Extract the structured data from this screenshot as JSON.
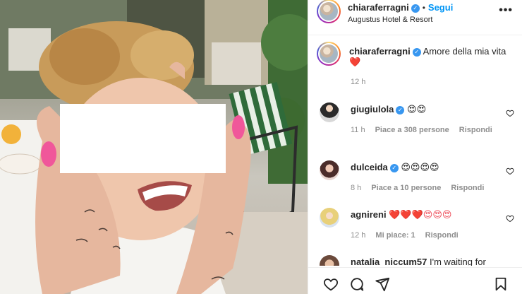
{
  "post": {
    "author": "chiaraferragni",
    "follow_label": "Segui",
    "separator": "•",
    "location": "Augustus Hotel & Resort",
    "more_icon": "more-horizontal-icon"
  },
  "caption": {
    "author": "chiaraferragni",
    "text": "Amore della mia vita",
    "emoji": "❤️",
    "time": "12 h"
  },
  "comments": [
    {
      "author": "giugiulola",
      "verified": true,
      "text": "😍😍",
      "time": "11 h",
      "likes": "Piace a 308 persone",
      "reply": "Rispondi"
    },
    {
      "author": "dulceida",
      "verified": true,
      "text": "😍😍😍😍",
      "time": "8 h",
      "likes": "Piace a 10 persone",
      "reply": "Rispondi"
    },
    {
      "author": "agnireni",
      "verified": false,
      "text": "❤️❤️❤️😍😍😍",
      "time": "12 h",
      "likes": "Mi piace: 1",
      "reply": "Rispondi"
    },
    {
      "author": "natalia_niccum57",
      "verified": false,
      "text": "I'm waiting for"
    }
  ],
  "actions": [
    "heart-icon",
    "comment-icon",
    "share-icon",
    "bookmark-icon"
  ],
  "colors": {
    "accent": "#0095f6",
    "verified": "#3897f0",
    "heart": "#ed4956",
    "text": "#262626",
    "muted": "#8e8e8e"
  }
}
